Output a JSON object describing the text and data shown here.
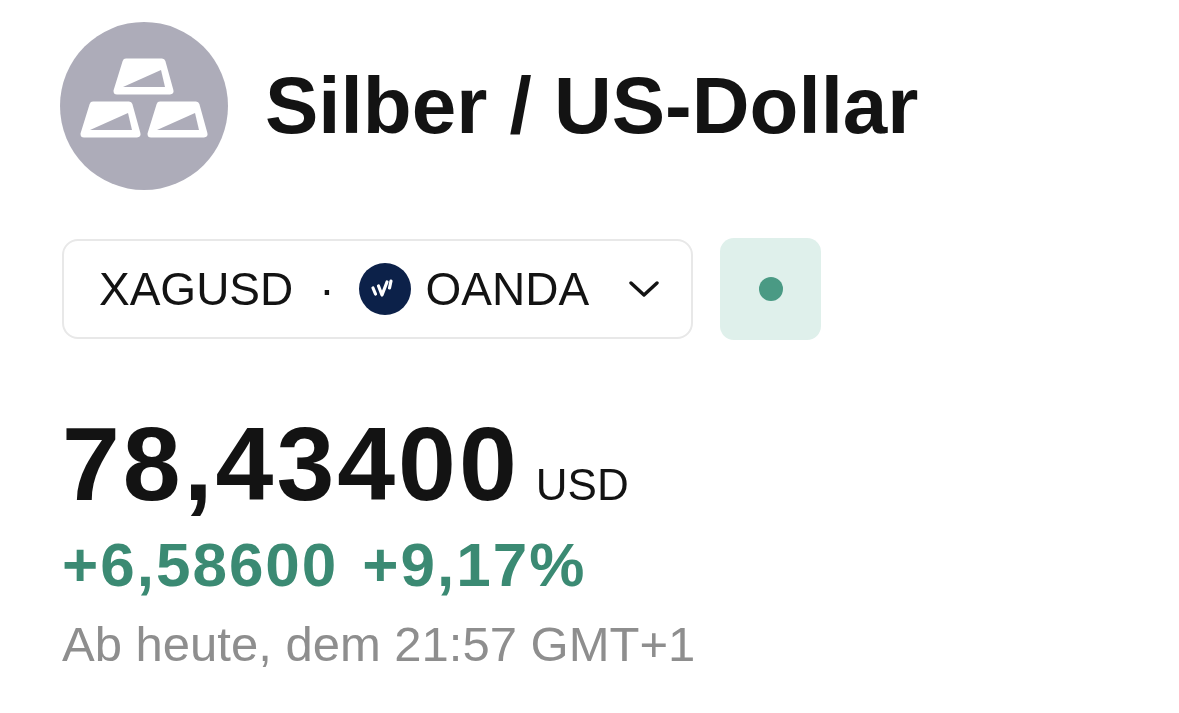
{
  "header": {
    "title": "Silber / US-Dollar"
  },
  "symbol": {
    "ticker": "XAGUSD",
    "separator": "·",
    "exchange": "OANDA"
  },
  "market_status": {
    "open": true
  },
  "quote": {
    "price": "78,43400",
    "currency": "USD",
    "change": "+6,58600",
    "change_percent": "+9,17%",
    "positive": true,
    "timestamp": "Ab heute, dem 21:57 GMT+1"
  }
}
